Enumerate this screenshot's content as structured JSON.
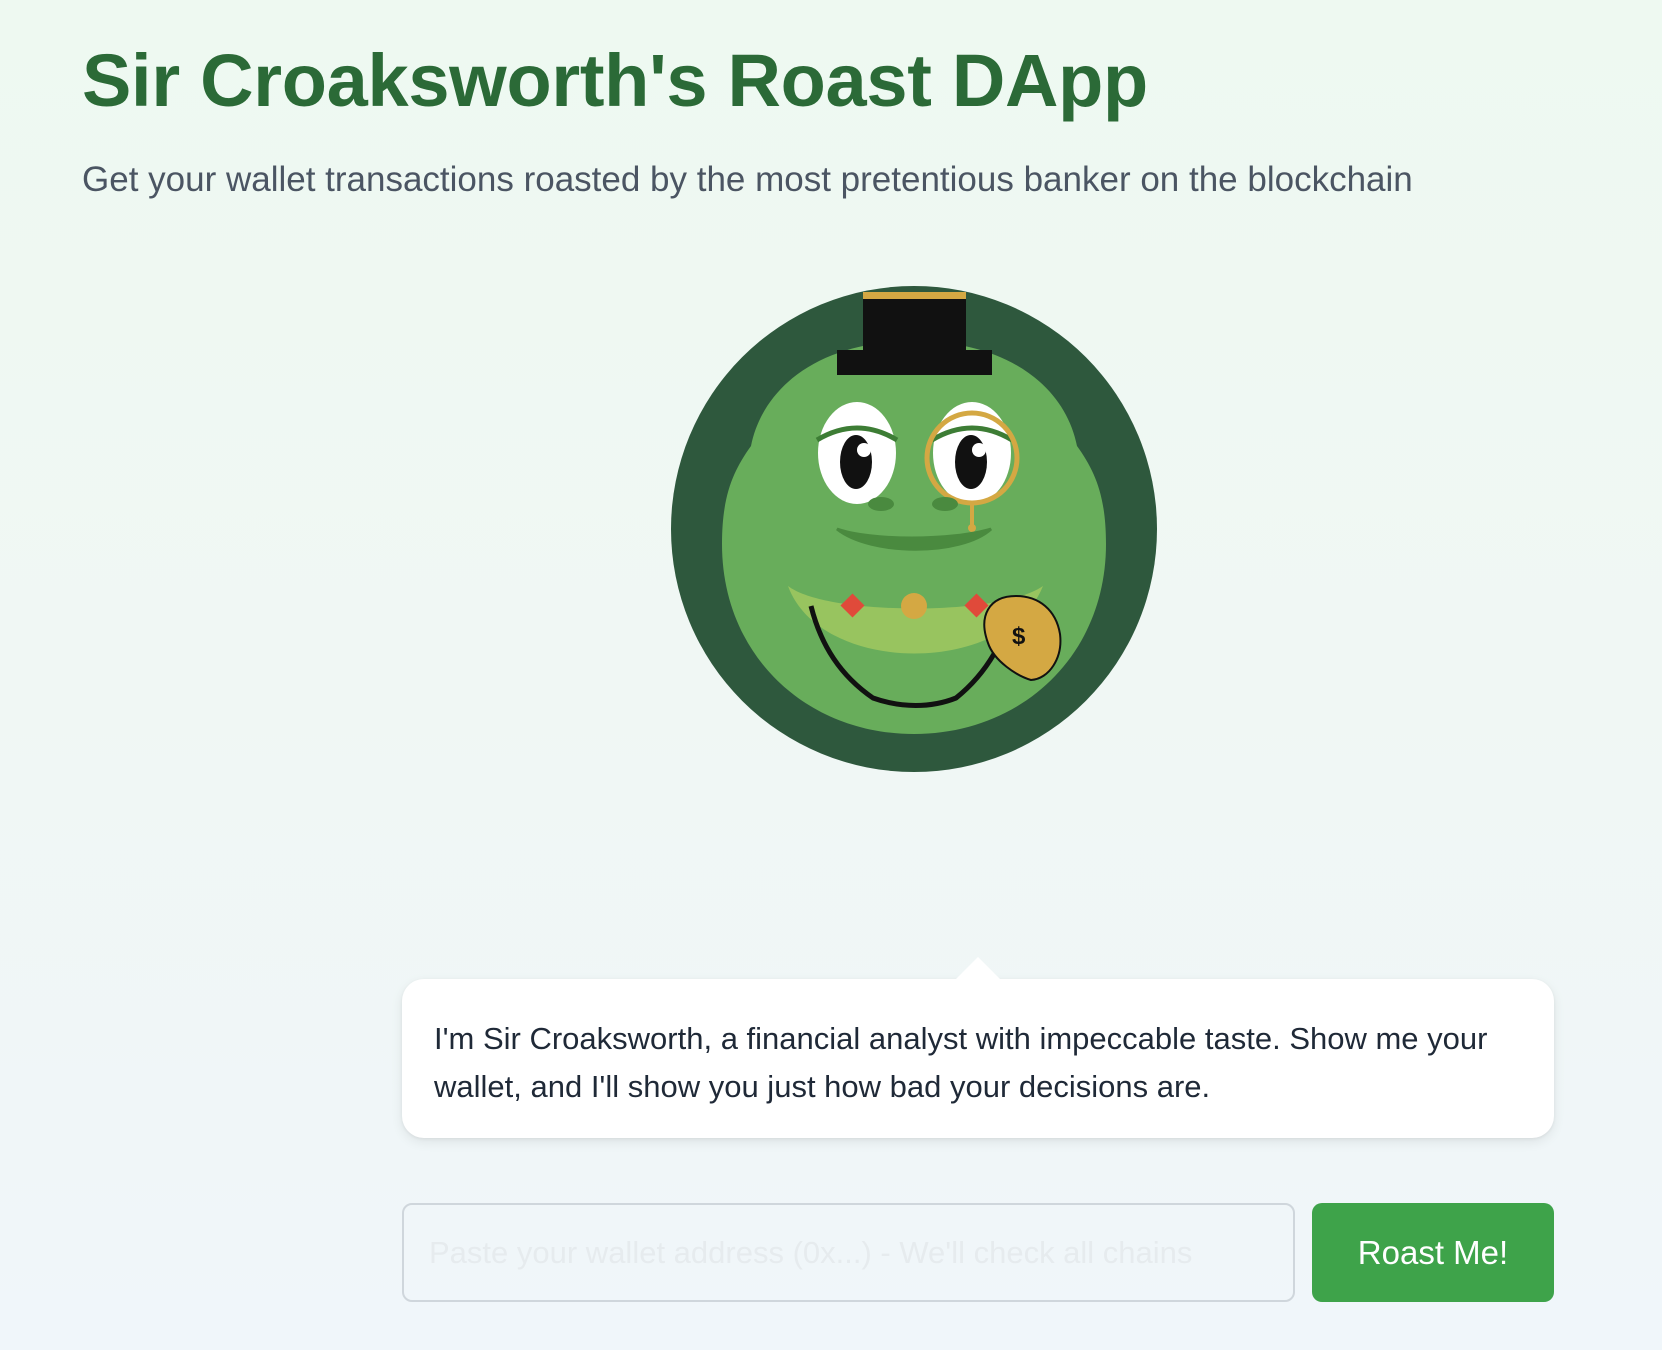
{
  "page": {
    "title": "Sir Croaksworth's Roast DApp",
    "subtitle": "Get your wallet transactions roasted by the most pretentious banker on the blockchain"
  },
  "mascot": {
    "icon": "frog-banker-icon",
    "money_bag_symbol": "$"
  },
  "bubble": {
    "text": "I'm Sir Croaksworth, a financial analyst with impeccable taste. Show me your wallet, and I'll show you just how bad your decisions are."
  },
  "form": {
    "wallet_input": {
      "value": "",
      "placeholder": "Paste your wallet address (0x...) - We'll check all chains"
    },
    "submit_label": "Roast Me!"
  },
  "colors": {
    "title": "#2b6a37",
    "button": "#3ea34a",
    "frog_outer": "#2e583d",
    "frog_skin": "#68ad5b",
    "frog_belly": "#98c45f",
    "gold": "#d4a843"
  }
}
